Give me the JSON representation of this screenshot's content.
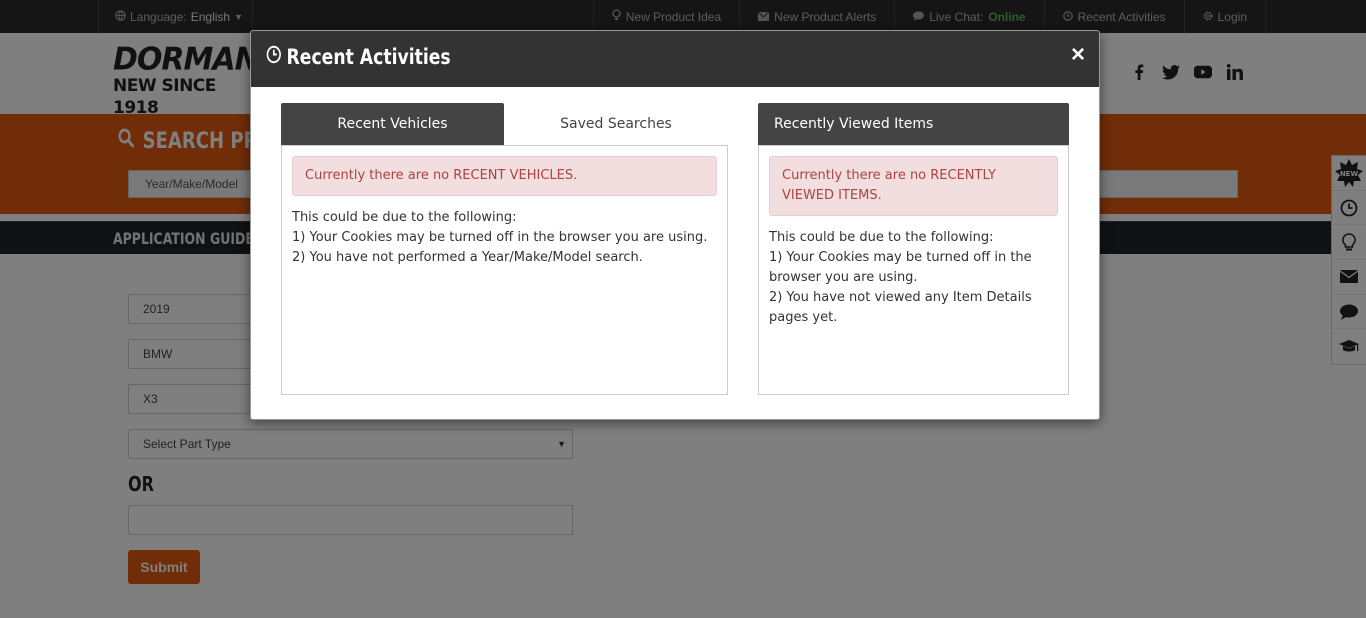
{
  "topbar": {
    "language_label": "Language:",
    "language_value": "English",
    "nav": [
      {
        "icon": "lightbulb-icon",
        "label": "New Product Idea"
      },
      {
        "icon": "envelope-icon",
        "label": "New Product Alerts"
      },
      {
        "icon": "chat-icon",
        "label": "Live Chat:"
      },
      {
        "icon": "clock-icon",
        "label": "Recent Activities"
      },
      {
        "icon": "gear-icon",
        "label": "Login"
      }
    ],
    "chat_status": "Online"
  },
  "header": {
    "logo_line1": "DORMAN",
    "logo_line2": "NEW SINCE 1918",
    "social": [
      "facebook-icon",
      "twitter-icon",
      "youtube-icon",
      "linkedin-icon"
    ]
  },
  "search": {
    "title": "SEARCH PRODUCTS",
    "input_text": "Year/Make/Model"
  },
  "appguide": {
    "title": "APPLICATION GUIDE SEARCH"
  },
  "form": {
    "year": "2019",
    "make": "BMW",
    "model": "X3",
    "part_type": "Select Part Type",
    "or_label": "OR",
    "search_value": "",
    "submit_label": "Submit"
  },
  "side_widget": [
    "new-badge-icon",
    "clock-icon",
    "lightbulb-icon",
    "envelope-icon",
    "chat-icon",
    "graduation-cap-icon"
  ],
  "modal": {
    "title": "Recent Activities",
    "close": "×",
    "tabs": [
      {
        "label": "Recent Vehicles",
        "active": true
      },
      {
        "label": "Saved Searches",
        "active": false
      }
    ],
    "vehicles": {
      "alert": "Currently there are no RECENT VEHICLES.",
      "lines": [
        "This could be due to the following:",
        "1) Your Cookies may be turned off in the browser you are using.",
        "2) You have not performed a Year/Make/Model search."
      ]
    },
    "viewed": {
      "title": "Recently Viewed Items",
      "alert": "Currently there are no RECENTLY VIEWED ITEMS.",
      "lines": [
        "This could be due to the following:",
        "1) Your Cookies may be turned off in the browser you are using.",
        "2) You have not viewed any Item Details pages yet."
      ]
    }
  },
  "colors": {
    "brand_orange": "#e05a0e",
    "dark_header": "#333333",
    "alert_bg": "#f2dede",
    "alert_text": "#a94442",
    "online_green": "#5cb85c"
  }
}
